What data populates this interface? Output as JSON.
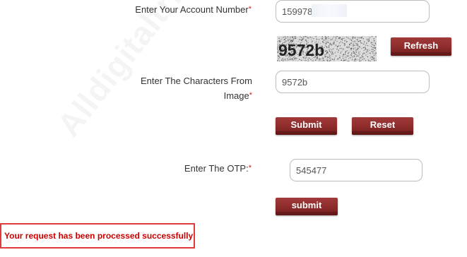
{
  "form": {
    "account_label": "Enter Your Account Number",
    "account_value": "159978",
    "captcha_text": "9572b",
    "refresh_label": "Refresh",
    "chars_label_line1": "Enter The Characters From",
    "chars_label_line2": "Image",
    "chars_value": "9572b",
    "submit_label": "Submit",
    "reset_label": "Reset",
    "otp_label": "Enter The OTP:",
    "otp_value": "545477",
    "otp_submit_label": "submit",
    "required_mark": "*"
  },
  "status": {
    "message": "Your request has been processed successfully"
  },
  "watermark": "Alldigitaltricks.Com",
  "colors": {
    "button": "#8d2b2b",
    "required": "#cc2222",
    "success_text": "#cc0000",
    "success_border": "#e03c3c"
  }
}
